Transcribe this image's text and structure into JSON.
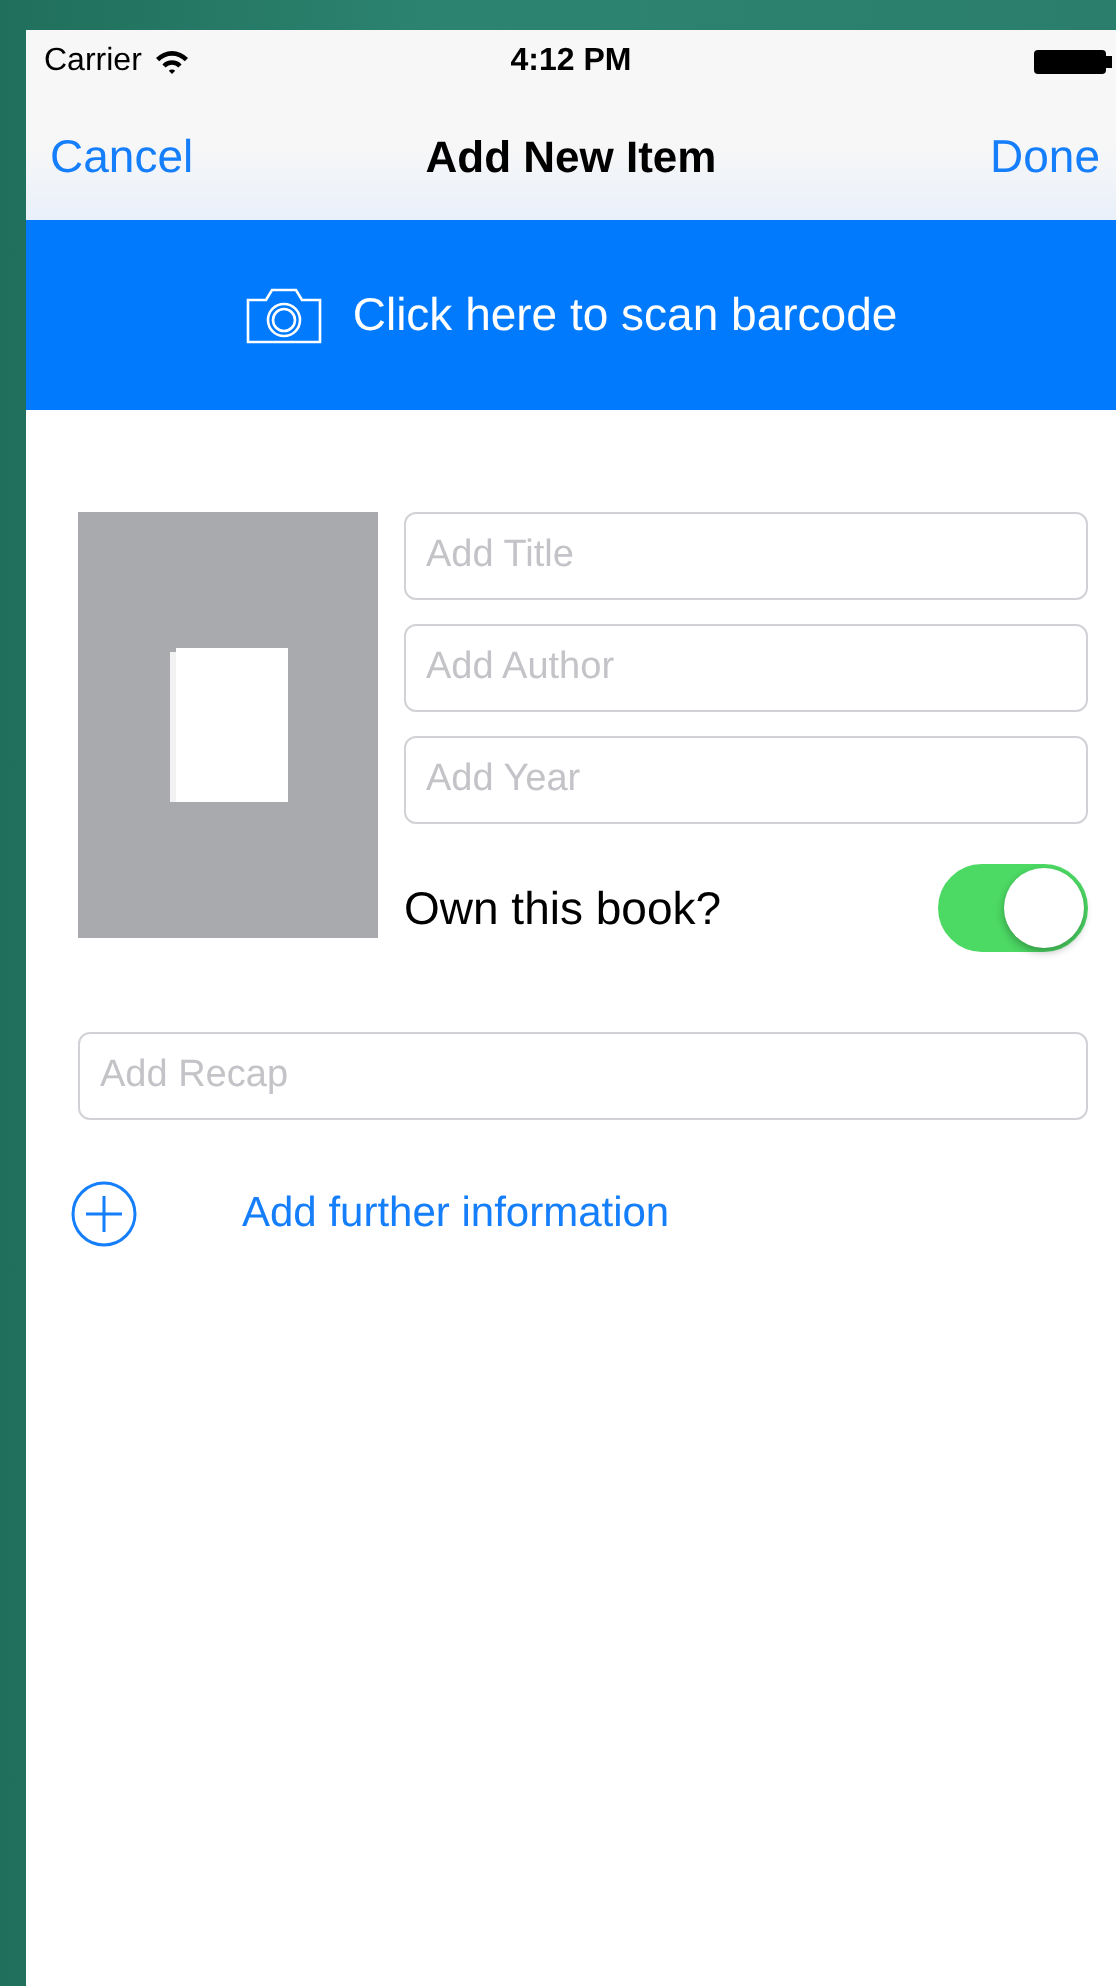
{
  "status_bar": {
    "carrier": "Carrier",
    "time": "4:12 PM"
  },
  "nav_bar": {
    "left": "Cancel",
    "title": "Add New Item",
    "right": "Done"
  },
  "scan_banner": {
    "label": "Click here to scan barcode"
  },
  "fields": [
    {
      "placeholder": "Add Title"
    },
    {
      "placeholder": "Add Author"
    },
    {
      "placeholder": "Add Year"
    }
  ],
  "own_toggle": {
    "label": "Own this book?",
    "on": true
  },
  "recap": {
    "placeholder": "Add Recap"
  },
  "further": {
    "label": "Add further information"
  }
}
